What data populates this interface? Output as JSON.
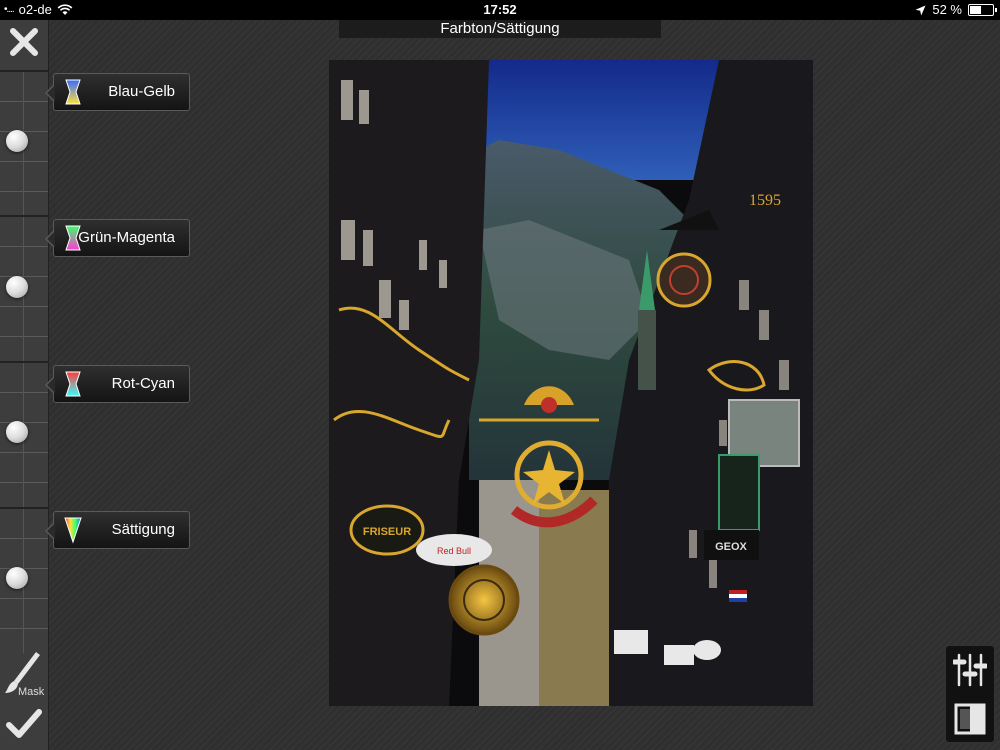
{
  "status_bar": {
    "signal": "•....",
    "carrier": "o2-de",
    "time": "17:52",
    "battery": "52 %",
    "battery_level": 0.52
  },
  "title": "Farbton/Sättigung",
  "channels": [
    {
      "label": "Blau-Gelb",
      "colors": [
        "#3a6bff",
        "#ffe23a"
      ],
      "level": 0.5
    },
    {
      "label": "Grün-Magenta",
      "colors": [
        "#3aff6b",
        "#ff3ad6"
      ],
      "level": 0.5
    },
    {
      "label": "Rot-Cyan",
      "colors": [
        "#ff3a3a",
        "#3affff"
      ],
      "level": 0.5
    },
    {
      "label": "Sättigung",
      "colors": [
        "#ff3a3a",
        "#ffe23a",
        "#3aff6b",
        "#3a6bff"
      ],
      "level": 0.5
    }
  ],
  "sidebar": {
    "mask_label": "Mask"
  },
  "photo": {
    "description_icon": "photo-canvas"
  }
}
